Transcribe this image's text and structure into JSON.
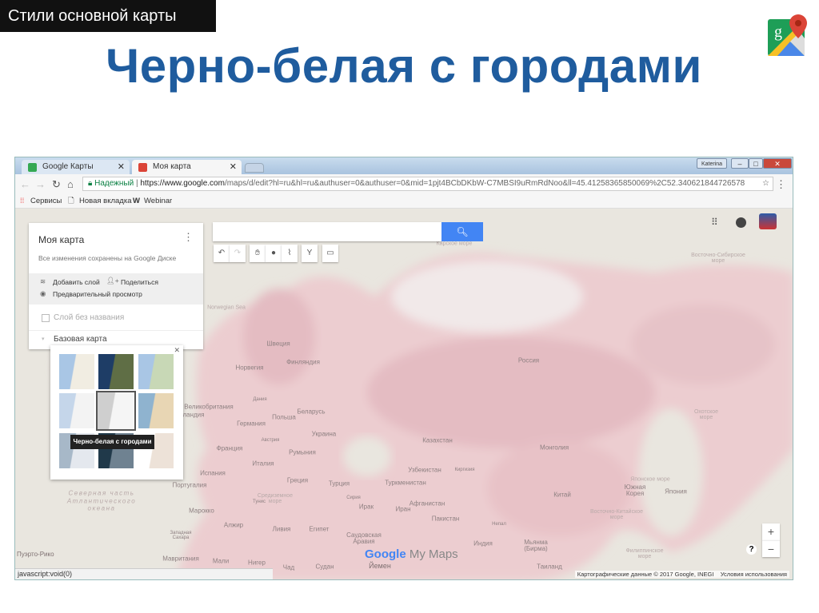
{
  "slide": {
    "tag": "Стили основной карты",
    "title": "Черно-белая с городами"
  },
  "browser": {
    "tabs": [
      {
        "label": "Google Карты",
        "close": "✕"
      },
      {
        "label": "Моя карта",
        "close": "✕"
      }
    ],
    "user": "Katerina",
    "secure_label": "Надежный",
    "url_host": "https://www.google.com",
    "url_path": "/maps/d/edit?hl=ru&hl=ru&authuser=0&authuser=0&mid=1pjt4BCbDKbW-C7MBSI9uRmRdNoo&ll=45.41258365850069%2C52.340621844726578",
    "bookmarks": [
      "Сервисы",
      "Новая вкладка",
      "Webinar"
    ],
    "status": "javascript:void(0)"
  },
  "panel": {
    "title": "Моя карта",
    "saved": "Все изменения сохранены на Google Диске",
    "add_layer": "Добавить слой",
    "share": "Поделиться",
    "preview": "Предварительный просмотр",
    "layer": "Слой без названия",
    "base_map": "Базовая карта"
  },
  "popup": {
    "tooltip": "Черно-белая с городами",
    "close": "✕"
  },
  "map": {
    "labels": [
      "Norwegian Sea",
      "Швеция",
      "Финляндия",
      "Норвегия",
      "Дания",
      "Великобритания",
      "Ирландия",
      "Беларусь",
      "Польша",
      "Германия",
      "Украина",
      "Австрия",
      "Франция",
      "Румыния",
      "Италия",
      "Испания",
      "Греция",
      "Турция",
      "Португалия",
      "Казахстан",
      "Узбекистан",
      "Киргизия",
      "Туркменистан",
      "Афганистан",
      "Сирия",
      "Тунис",
      "Ирак",
      "Россия",
      "Монголия",
      "Китай",
      "Южная Корея",
      "Япония",
      "Иран",
      "Пакистан",
      "Непал",
      "Индия",
      "Мьянма (Бирма)",
      "Таиланд",
      "Саудовская Аравия",
      "Йемен",
      "Марокко",
      "Алжир",
      "Ливия",
      "Египет",
      "Западная Сахара",
      "Мавритания",
      "Мали",
      "Нигер",
      "Чад",
      "Судан",
      "Пуэрто-Рико"
    ],
    "seas": [
      "Карское море",
      "Восточно-Сибирское море",
      "Охотское море",
      "Японское море",
      "Восточно-Китайское море",
      "Филиппинское море",
      "Средиземное море",
      "Северная часть Атлантического океана"
    ],
    "brand": "Google",
    "brand_suffix": "My Maps",
    "attribution": "Картографические данные © 2017 Google, INEGI",
    "terms": "Условия использования",
    "zoom_in": "+",
    "zoom_out": "−",
    "help": "?"
  }
}
